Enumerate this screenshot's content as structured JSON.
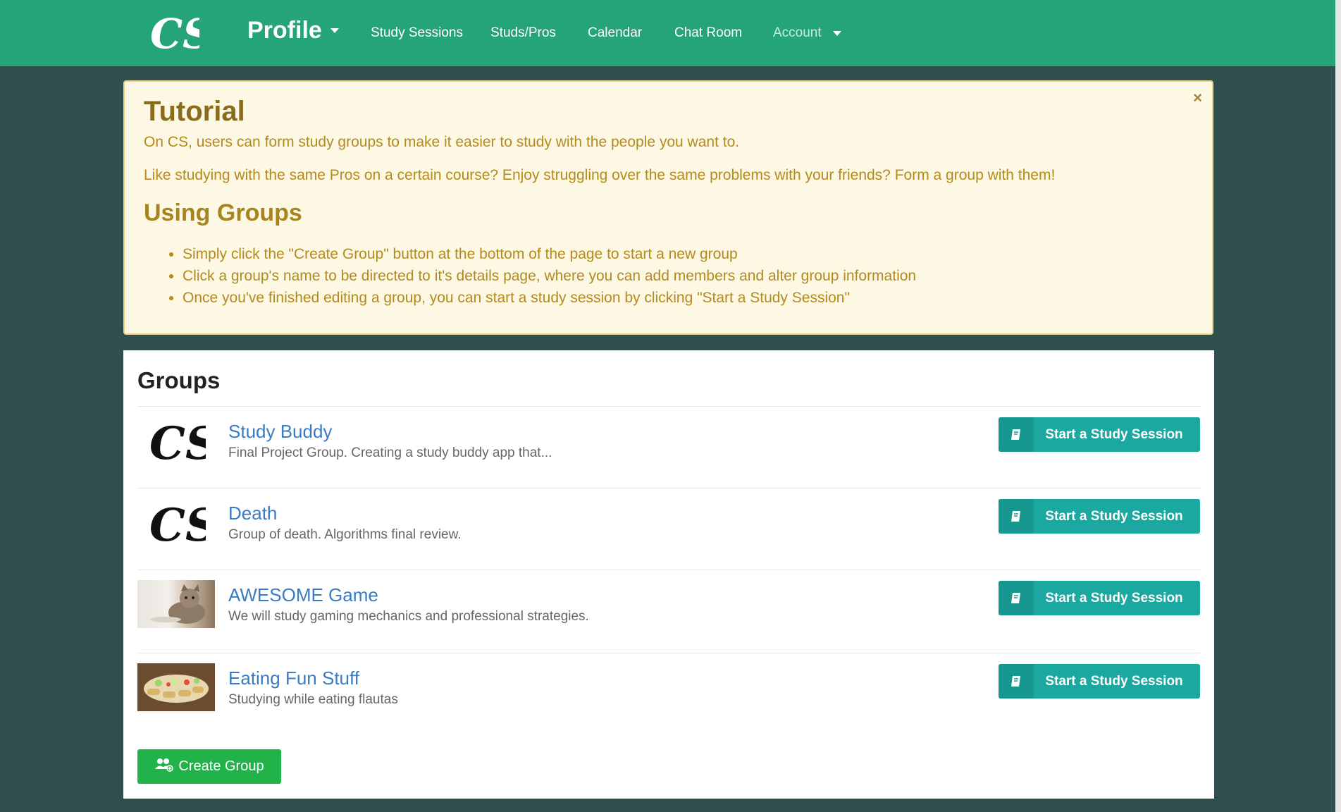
{
  "navbar": {
    "logo_text": "CS",
    "brand": "Profile",
    "links": [
      "Study Sessions",
      "Studs/Pros",
      "Calendar",
      "Chat Room"
    ],
    "account": "Account"
  },
  "tutorial": {
    "title": "Tutorial",
    "para1": "On CS, users can form study groups to make it easier to study with the people you want to.",
    "para2": "Like studying with the same Pros on a certain course? Enjoy struggling over the same problems with your friends? Form a group with them!",
    "subtitle": "Using Groups",
    "bullets": [
      "Simply click the \"Create Group\" button at the bottom of the page to start a new group",
      "Click a group's name to be directed to it's details page, where you can add members and alter group information",
      "Once you've finished editing a group, you can start a study session by clicking \"Start a Study Session\""
    ],
    "close": "×"
  },
  "groups": {
    "title": "Groups",
    "items": [
      {
        "name": "Study Buddy",
        "desc": "Final Project Group. Creating a study buddy app that...",
        "thumb": "cs-logo",
        "button": "Start a Study Session"
      },
      {
        "name": "Death",
        "desc": "Group of death. Algorithms final review.",
        "thumb": "cs-logo",
        "button": "Start a Study Session"
      },
      {
        "name": "AWESOME Game",
        "desc": "We will study gaming mechanics and professional strategies.",
        "thumb": "kitten-photo",
        "button": "Start a Study Session"
      },
      {
        "name": "Eating Fun Stuff",
        "desc": "Studying while eating flautas",
        "thumb": "flautas-photo",
        "button": "Start a Study Session"
      }
    ],
    "create_button": "Create Group"
  },
  "colors": {
    "navbar": "#25a478",
    "page_bg": "#2f4f4f",
    "alert_bg": "#fcf8e3",
    "study_button": "#1ba8a0",
    "create_button": "#21b24a",
    "link": "#3a7cc4"
  }
}
